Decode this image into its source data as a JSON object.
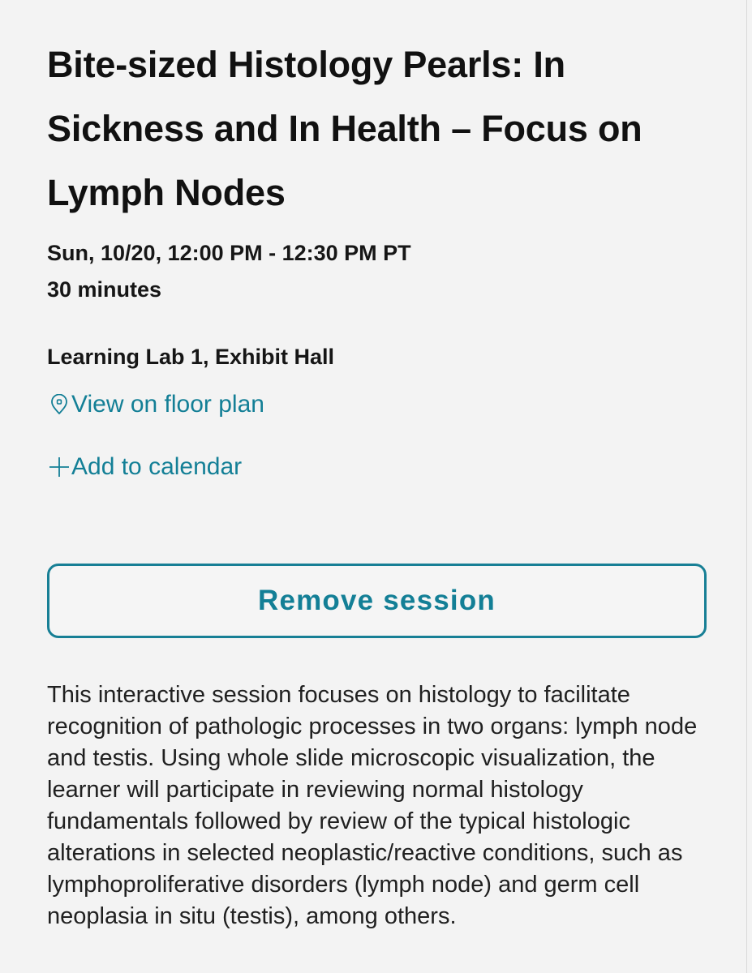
{
  "session": {
    "title": "Bite-sized Histology Pearls: In Sickness and In Health – Focus on Lymph Nodes",
    "datetime": "Sun, 10/20, 12:00 PM - 12:30 PM PT",
    "duration": "30 minutes",
    "location": "Learning Lab 1, Exhibit Hall",
    "floor_plan_link": "View on floor plan",
    "add_calendar_link": "Add to calendar",
    "remove_button": "Remove session",
    "description": "This interactive session focuses on histology to facilitate recognition of pathologic processes in two organs: lymph node and testis. Using whole slide microscopic visualization, the learner will participate in reviewing normal histology fundamentals followed by review of the typical histologic alterations in selected neoplastic/reactive conditions, such as lymphoproliferative disorders (lymph node) and germ cell neoplasia in situ (testis), among others."
  },
  "icons": {
    "floor_plan": "location-pin-icon",
    "calendar": "plus-icon"
  },
  "colors": {
    "accent": "#137f96",
    "background": "#f3f3f3",
    "text": "#111111"
  }
}
